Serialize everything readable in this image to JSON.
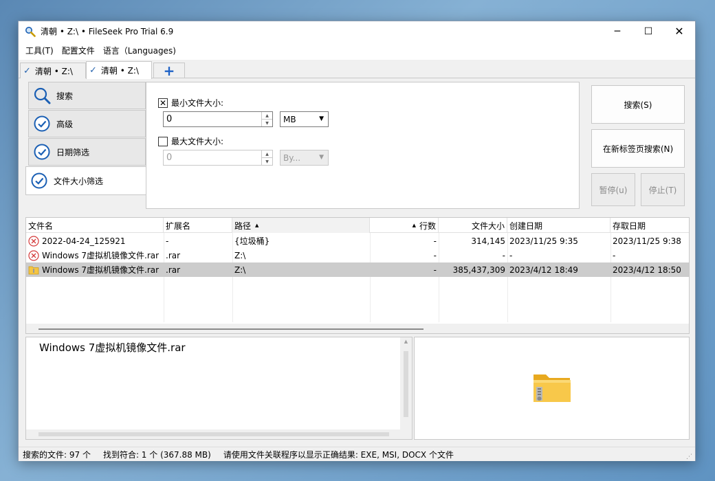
{
  "window": {
    "title": "清朝 • Z:\\ • FileSeek Pro Trial 6.9"
  },
  "controls": {
    "minimize": "─",
    "maximize": "☐",
    "close": "✕"
  },
  "menu": {
    "items": [
      "工具(T)",
      "配置文件",
      "语言（Languages)"
    ]
  },
  "tabs": [
    {
      "label": "清朝 • Z:\\"
    },
    {
      "label": "清朝 • Z:\\"
    }
  ],
  "add_tab": "+",
  "nav": {
    "items": [
      {
        "label": "搜索",
        "icon": "search-icon"
      },
      {
        "label": "高级",
        "icon": "check-circle-icon"
      },
      {
        "label": "日期筛选",
        "icon": "check-circle-icon"
      },
      {
        "label": "文件大小筛选",
        "icon": "check-circle-icon"
      }
    ]
  },
  "size_filter": {
    "min": {
      "label": "最小文件大小:",
      "checked": true,
      "value": "0",
      "unit": "MB"
    },
    "max": {
      "label": "最大文件大小:",
      "checked": false,
      "value": "0",
      "unit": "By..."
    }
  },
  "buttons": {
    "search": "搜索(S)",
    "search_new_tab": "在新标签页搜索(N)",
    "pause": "暂停(u)",
    "stop": "停止(T)"
  },
  "table": {
    "columns": [
      "文件名",
      "扩展名",
      "路径",
      "行数",
      "文件大小",
      "创建日期",
      "存取日期"
    ],
    "rows": [
      {
        "icon": "error-icon",
        "name": "2022-04-24_125921",
        "ext": "-",
        "path": "{垃圾桶}",
        "lines": "-",
        "size": "314,145",
        "created": "2023/11/25 9:35",
        "accessed": "2023/11/25 9:38"
      },
      {
        "icon": "error-icon",
        "name": "Windows 7虚拟机镜像文件.rar",
        "ext": ".rar",
        "path": "Z:\\",
        "lines": "-",
        "size": "-",
        "created": "-",
        "accessed": "-"
      },
      {
        "icon": "zip-folder-icon",
        "name": "Windows 7虚拟机镜像文件.rar",
        "ext": ".rar",
        "path": "Z:\\",
        "lines": "-",
        "size": "385,437,309",
        "created": "2023/4/12 18:49",
        "accessed": "2023/4/12 18:50"
      }
    ]
  },
  "preview": {
    "text": "Windows 7虚拟机镜像文件.rar"
  },
  "status": {
    "searched": "搜索的文件: 97 个",
    "found": "找到符合: 1 个 (367.88 MB)",
    "hint": "请使用文件关联程序以显示正确结果: EXE, MSI, DOCX 个文件"
  }
}
